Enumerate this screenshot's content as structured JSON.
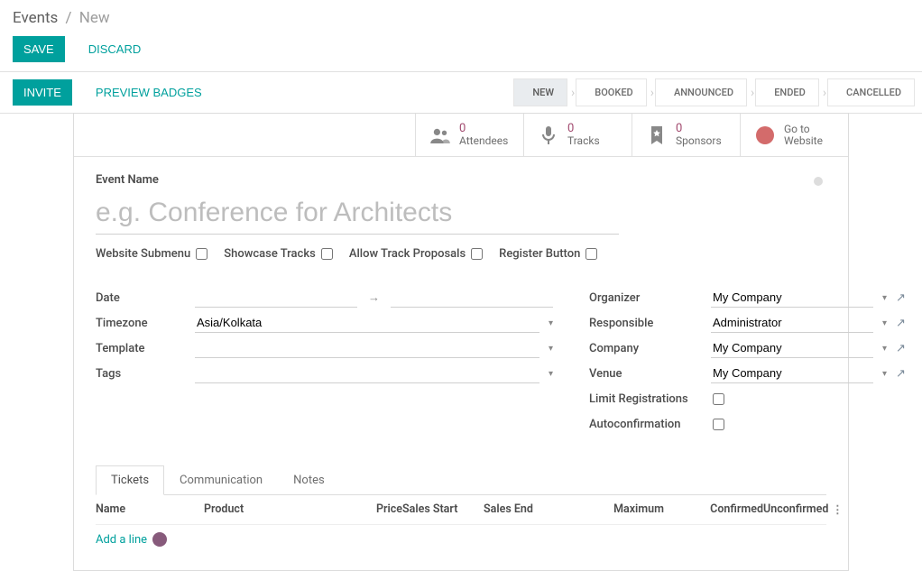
{
  "breadcrumb": {
    "root": "Events",
    "sep": "/",
    "current": "New"
  },
  "actions": {
    "save": "SAVE",
    "discard": "DISCARD",
    "invite": "INVITE",
    "preview_badges": "PREVIEW BADGES"
  },
  "stages": {
    "new": "NEW",
    "booked": "BOOKED",
    "announced": "ANNOUNCED",
    "ended": "ENDED",
    "cancelled": "CANCELLED"
  },
  "stats": {
    "attendees": {
      "num": "0",
      "lbl": "Attendees"
    },
    "tracks": {
      "num": "0",
      "lbl": "Tracks"
    },
    "sponsors": {
      "num": "0",
      "lbl": "Sponsors"
    },
    "website": {
      "line1": "Go to",
      "line2": "Website"
    }
  },
  "title": {
    "label": "Event Name",
    "placeholder": "e.g. Conference for Architects",
    "value": ""
  },
  "checks": {
    "website_submenu": "Website Submenu",
    "showcase_tracks": "Showcase Tracks",
    "allow_proposals": "Allow Track Proposals",
    "register_button": "Register Button"
  },
  "left": {
    "date": "Date",
    "timezone": {
      "label": "Timezone",
      "value": "Asia/Kolkata"
    },
    "template": "Template",
    "tags": "Tags"
  },
  "right": {
    "organizer": {
      "label": "Organizer",
      "value": "My Company"
    },
    "responsible": {
      "label": "Responsible",
      "value": "Administrator"
    },
    "company": {
      "label": "Company",
      "value": "My Company"
    },
    "venue": {
      "label": "Venue",
      "value": "My Company"
    },
    "limit": "Limit Registrations",
    "autoconfirm": "Autoconfirmation"
  },
  "tabs": {
    "tickets": "Tickets",
    "communication": "Communication",
    "notes": "Notes"
  },
  "table": {
    "name": "Name",
    "product": "Product",
    "price": "Price",
    "sales_start": "Sales Start",
    "sales_end": "Sales End",
    "maximum": "Maximum",
    "confirmed": "Confirmed",
    "unconfirmed": "Unconfirmed",
    "add_line": "Add a line"
  }
}
